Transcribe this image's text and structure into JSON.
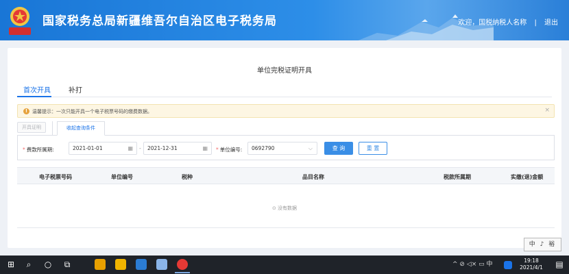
{
  "header": {
    "title": "国家税务总局新疆维吾尔自治区电子税务局",
    "emblem_text": "中国税务",
    "welcome": "欢迎，国税纳税人名称",
    "separator": "|",
    "logout": "退出"
  },
  "page": {
    "title": "单位完税证明开具",
    "tabs": [
      {
        "label": "首次开具",
        "active": true
      },
      {
        "label": "补打",
        "active": false
      }
    ],
    "alert": {
      "icon": "warning-icon",
      "icon_glyph": "!",
      "text": "温馨提示：一次只能开具一个电子税票号码的缴费数据。",
      "close": "×"
    },
    "issue_button": "开具证明",
    "sub_tab": "收起查询条件"
  },
  "search": {
    "period_label": "费款所属期:",
    "required_mark": "*",
    "date_from": "2021-01-01",
    "date_to": "2021-12-31",
    "date_sep": "-",
    "unit_label": "单位编号:",
    "unit_value": "0692790",
    "query_button": "查 询",
    "reset_button": "重 置"
  },
  "table": {
    "columns": [
      "电子税票号码",
      "单位编号",
      "税种",
      "品目名称",
      "税款所属期",
      "实缴(退)金额"
    ],
    "rows": [],
    "empty_text": "没有数据"
  },
  "ime": {
    "text": "中 ♪ 裕"
  },
  "taskbar": {
    "time": "19:18",
    "date": "2021/4/1",
    "tray_text": "^ ⊘ ◁× ▭ 中"
  },
  "colors": {
    "header_blue": "#1976d6",
    "accent": "#1a73e8",
    "alert_bg": "#fdf6e3",
    "warning": "#e6a23c",
    "required": "#f56c6c"
  }
}
